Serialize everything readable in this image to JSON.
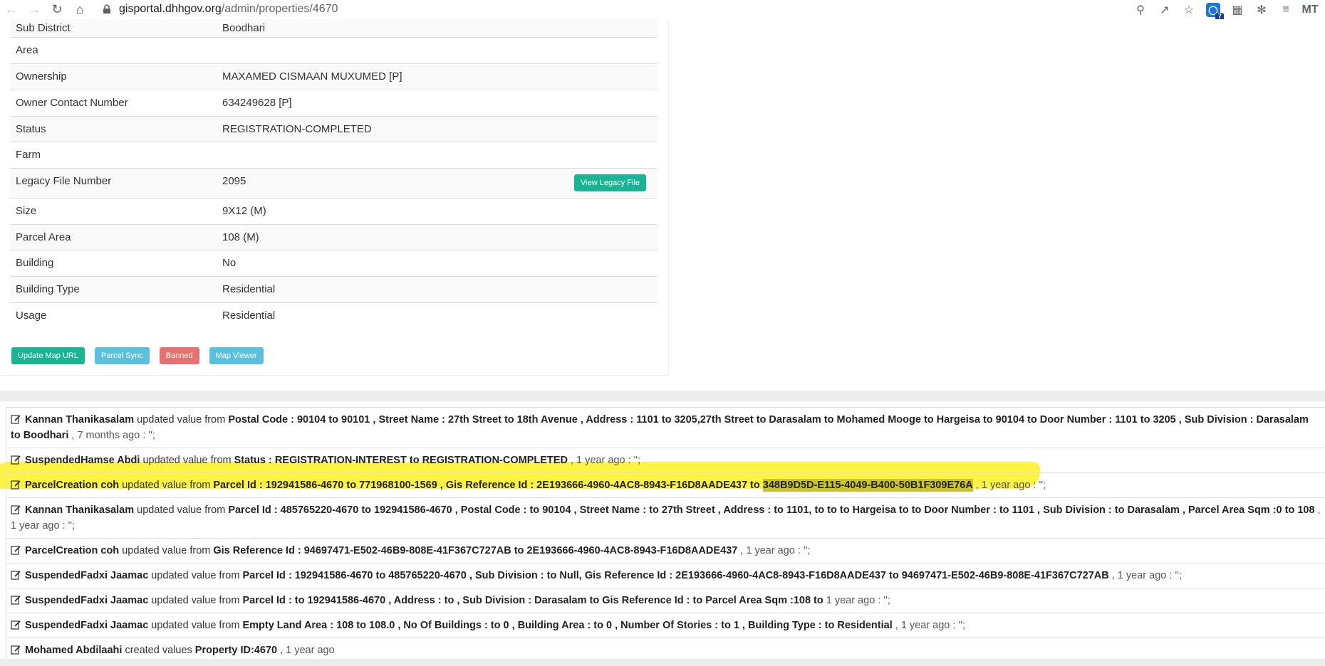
{
  "browser": {
    "url_host": "gisportal.dhhgov.org",
    "url_path": "/admin/properties/4670",
    "extension_badge": "7",
    "profile_text": "MT"
  },
  "properties": [
    {
      "label": "Sub District",
      "value": "Boodhari"
    },
    {
      "label": "Area",
      "value": ""
    },
    {
      "label": "Ownership",
      "value": "MAXAMED CISMAAN MUXUMED [P]"
    },
    {
      "label": "Owner Contact Number",
      "value": "634249628 [P]"
    },
    {
      "label": "Status",
      "value": "REGISTRATION-COMPLETED"
    },
    {
      "label": "Farm",
      "value": ""
    },
    {
      "label": "Legacy File Number",
      "value": "2095"
    },
    {
      "label": "Size",
      "value": "9X12 (M)"
    },
    {
      "label": "Parcel Area",
      "value": "108 (M)"
    },
    {
      "label": "Building",
      "value": "No"
    },
    {
      "label": "Building Type",
      "value": "Residential"
    },
    {
      "label": "Usage",
      "value": "Residential"
    }
  ],
  "legacy_button": "View Legacy File",
  "actions": {
    "update_map_url": "Update Map URL",
    "parcel_sync": "Parcel Sync",
    "banned": "Banned",
    "map_viewer": "Map Viewer"
  },
  "log": [
    {
      "user": "Kannan Thanikasalam",
      "verb": " updated value from ",
      "detail": "Postal Code : 90104 to 90101 , Street Name : 27th Street to 18th Avenue , Address : 1101 to 3205,27th Street to Darasalam to Mohamed Mooge to Hargeisa to 90104 to Door Number : 1101 to 3205 , Sub Division : Darasalam to Boodhari",
      "time": " , 7 months ago : '';"
    },
    {
      "user": "SuspendedHamse Abdi",
      "verb": " updated value from ",
      "detail": "Status : REGISTRATION-INTEREST to REGISTRATION-COMPLETED",
      "time": " , 1 year ago : '';"
    },
    {
      "user": "ParcelCreation coh",
      "verb": " updated value from ",
      "detail": "Parcel Id : 192941586-4670 to 771968100-1569 , Gis Reference Id : 2E193666-4960-4AC8-8943-F16D8AADE437 to ",
      "detail_highlight": "348B9D5D-E115-4049-B400-50B1F309E76A",
      "time": " , 1 year ago : '';"
    },
    {
      "user": "Kannan Thanikasalam",
      "verb": " updated value from ",
      "detail": "Parcel Id : 485765220-4670 to 192941586-4670 , Postal Code : to 90104 , Street Name : to 27th Street , Address : to 1101, to to to Hargeisa to to Door Number : to 1101 , Sub Division : to Darasalam , Parcel Area Sqm :0 to 108",
      "time": " , 1 year ago : '';"
    },
    {
      "user": "ParcelCreation coh",
      "verb": " updated value from ",
      "detail": "Gis Reference Id : 94697471-E502-46B9-808E-41F367C727AB to 2E193666-4960-4AC8-8943-F16D8AADE437",
      "time": " , 1 year ago : '';"
    },
    {
      "user": "SuspendedFadxi Jaamac",
      "verb": " updated value from ",
      "detail": "Parcel Id : 192941586-4670 to 485765220-4670 , Sub Division : to Null, Gis Reference Id : 2E193666-4960-4AC8-8943-F16D8AADE437 to 94697471-E502-46B9-808E-41F367C727AB",
      "time": " , 1 year ago : '';"
    },
    {
      "user": "SuspendedFadxi Jaamac",
      "verb": " updated value from ",
      "detail": "Parcel Id : to 192941586-4670 , Address : to , Sub Division : Darasalam to Gis Reference Id : to Parcel Area Sqm :108 to",
      "time": " 1 year ago : '';"
    },
    {
      "user": "SuspendedFadxi Jaamac",
      "verb": " updated value from ",
      "detail": "Empty Land Area : 108 to 108.0 , No Of Buildings : to 0 , Building Area : to 0 , Number Of Stories : to 1 , Building Type : to Residential",
      "time": " , 1 year ago : '';"
    },
    {
      "user": "Mohamed Abdilaahi",
      "verb": " created values ",
      "detail": "Property ID:4670",
      "time": " , 1 year ago"
    }
  ]
}
